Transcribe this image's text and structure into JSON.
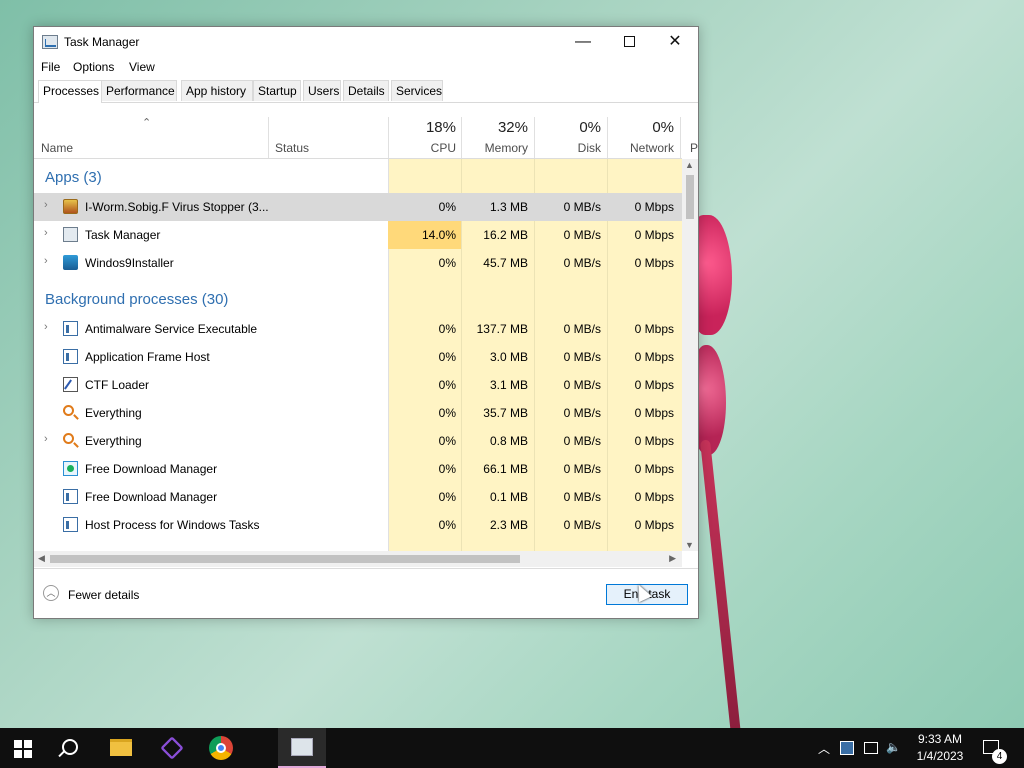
{
  "window": {
    "title": "Task Manager",
    "controls": {
      "minimize": "—",
      "close": "✕"
    }
  },
  "menu": {
    "file": "File",
    "options": "Options",
    "view": "View"
  },
  "tabs": [
    "Processes",
    "Performance",
    "App history",
    "Startup",
    "Users",
    "Details",
    "Services"
  ],
  "header": {
    "name": "Name",
    "status": "Status",
    "cpu": {
      "pct": "18%",
      "label": "CPU"
    },
    "memory": {
      "pct": "32%",
      "label": "Memory"
    },
    "disk": {
      "pct": "0%",
      "label": "Disk"
    },
    "network": {
      "pct": "0%",
      "label": "Network"
    },
    "power": "P"
  },
  "groups": {
    "apps": "Apps (3)",
    "background": "Background processes (30)"
  },
  "apps": [
    {
      "name": "I-Worm.Sobig.F Virus Stopper (3...",
      "cpu": "0%",
      "mem": "1.3 MB",
      "disk": "0 MB/s",
      "net": "0 Mbps",
      "icon": "virus-stopper-icon"
    },
    {
      "name": "Task Manager",
      "cpu": "14.0%",
      "mem": "16.2 MB",
      "disk": "0 MB/s",
      "net": "0 Mbps",
      "icon": "task-manager-icon"
    },
    {
      "name": "Windos9Installer",
      "cpu": "0%",
      "mem": "45.7 MB",
      "disk": "0 MB/s",
      "net": "0 Mbps",
      "icon": "installer-icon"
    }
  ],
  "background": [
    {
      "name": "Antimalware Service Executable",
      "cpu": "0%",
      "mem": "137.7 MB",
      "disk": "0 MB/s",
      "net": "0 Mbps",
      "icon": "window-app-icon"
    },
    {
      "name": "Application Frame Host",
      "cpu": "0%",
      "mem": "3.0 MB",
      "disk": "0 MB/s",
      "net": "0 Mbps",
      "icon": "window-app-icon"
    },
    {
      "name": "CTF Loader",
      "cpu": "0%",
      "mem": "3.1 MB",
      "disk": "0 MB/s",
      "net": "0 Mbps",
      "icon": "ctf-loader-icon"
    },
    {
      "name": "Everything",
      "cpu": "0%",
      "mem": "35.7 MB",
      "disk": "0 MB/s",
      "net": "0 Mbps",
      "icon": "magnifier-icon"
    },
    {
      "name": "Everything",
      "cpu": "0%",
      "mem": "0.8 MB",
      "disk": "0 MB/s",
      "net": "0 Mbps",
      "icon": "magnifier-icon"
    },
    {
      "name": "Free Download Manager",
      "cpu": "0%",
      "mem": "66.1 MB",
      "disk": "0 MB/s",
      "net": "0 Mbps",
      "icon": "download-manager-icon"
    },
    {
      "name": "Free Download Manager",
      "cpu": "0%",
      "mem": "0.1 MB",
      "disk": "0 MB/s",
      "net": "0 Mbps",
      "icon": "window-app-icon"
    },
    {
      "name": "Host Process for Windows Tasks",
      "cpu": "0%",
      "mem": "2.3 MB",
      "disk": "0 MB/s",
      "net": "0 Mbps",
      "icon": "window-app-icon"
    }
  ],
  "footer": {
    "fewer_details": "Fewer details",
    "end_task": "End task"
  },
  "taskbar": {
    "time": "9:33 AM",
    "date": "1/4/2023",
    "notifications": "4"
  },
  "colors": {
    "accent": "#0078d7",
    "group_title": "#2f6fb0",
    "cpu_highlight": "#ffd97a",
    "col_tint": "#fff4c4"
  }
}
